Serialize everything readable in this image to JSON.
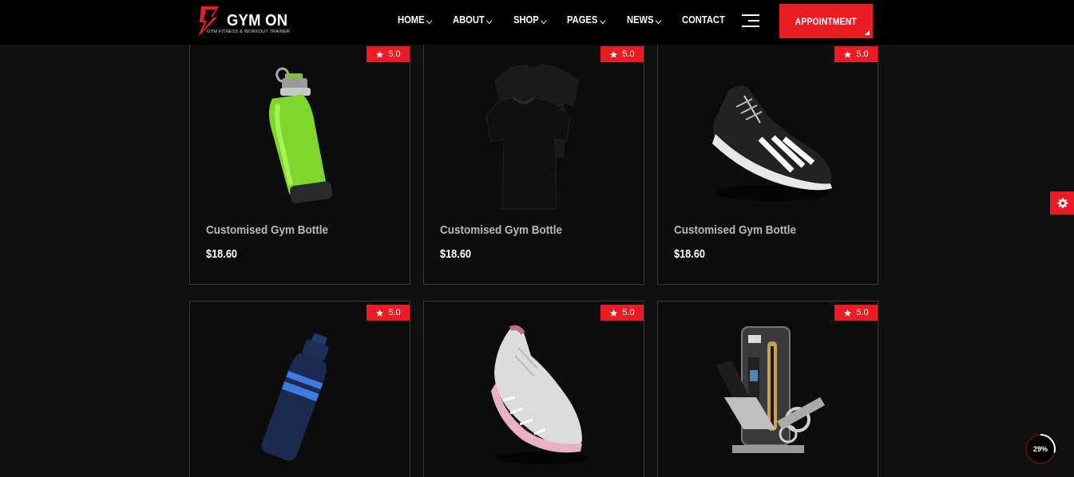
{
  "brand": {
    "name": "GYM ON",
    "tagline": "GYM FITNESS & WORKOUT TRAINER",
    "accent_color": "#ec1c24"
  },
  "nav": {
    "items": [
      {
        "label": "HOME",
        "has_dropdown": true
      },
      {
        "label": "ABOUT",
        "has_dropdown": true
      },
      {
        "label": "SHOP",
        "has_dropdown": true
      },
      {
        "label": "PAGES",
        "has_dropdown": true
      },
      {
        "label": "NEWS",
        "has_dropdown": true
      },
      {
        "label": "CONTACT",
        "has_dropdown": false
      }
    ],
    "menu_icon": "hamburger-icon",
    "appointment_label": "APPOINTMENT"
  },
  "products": [
    {
      "name": "Customised Gym Bottle",
      "price": "$18.60",
      "rating": "5.0",
      "image": "green-bottle"
    },
    {
      "name": "Customised Gym Bottle",
      "price": "$18.60",
      "rating": "5.0",
      "image": "black-tshirt"
    },
    {
      "name": "Customised Gym Bottle",
      "price": "$18.60",
      "rating": "5.0",
      "image": "black-sneaker"
    },
    {
      "name": "",
      "price": "",
      "rating": "5.0",
      "image": "blue-bottle"
    },
    {
      "name": "",
      "price": "",
      "rating": "5.0",
      "image": "white-pink-sneaker"
    },
    {
      "name": "",
      "price": "",
      "rating": "5.0",
      "image": "leg-extension-machine"
    }
  ],
  "widgets": {
    "settings_icon": "gear-icon",
    "scroll_progress_label": "29%",
    "scroll_progress_value": 0.29
  }
}
